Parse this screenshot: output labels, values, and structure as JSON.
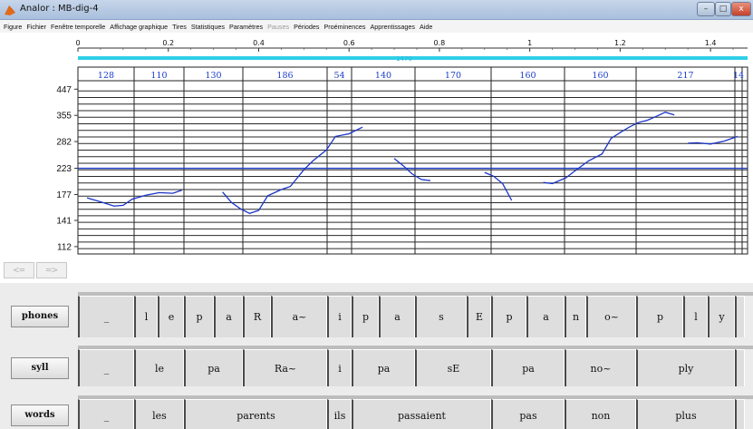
{
  "window": {
    "title": "Analor : MB-dig-4",
    "icon": "matlab-icon",
    "controls": {
      "minimize": "–",
      "maximize": "□",
      "close": "x"
    }
  },
  "menu": {
    "items": [
      {
        "label": "Figure",
        "enabled": true
      },
      {
        "label": "Fichier",
        "enabled": true
      },
      {
        "label": "Fenêtre temporelle",
        "enabled": true
      },
      {
        "label": "Affichage graphique",
        "enabled": true
      },
      {
        "label": "Tires",
        "enabled": true
      },
      {
        "label": "Statistiques",
        "enabled": true
      },
      {
        "label": "Paramètres",
        "enabled": true
      },
      {
        "label": "Pauses",
        "enabled": false
      },
      {
        "label": "Périodes",
        "enabled": true
      },
      {
        "label": "Proéminences",
        "enabled": true
      },
      {
        "label": "Apprentissages",
        "enabled": true
      },
      {
        "label": "Aide",
        "enabled": true
      }
    ]
  },
  "time_axis": {
    "range": [
      0,
      1.47
    ],
    "ticks": [
      "0",
      "0.2",
      "0.4",
      "0.6",
      "0.8",
      "1",
      "1.2",
      "1.4"
    ],
    "duration_label": "1470",
    "bar_color": "#2fd0e8"
  },
  "segment_durations": [
    "128",
    "110",
    "130",
    "186",
    "54",
    "140",
    "170",
    "160",
    "160",
    "217",
    "14"
  ],
  "chart_data": {
    "type": "line",
    "title": "",
    "xlabel": "",
    "ylabel": "",
    "y_ticks": [
      "447",
      "355",
      "282",
      "223",
      "177",
      "141",
      "112"
    ],
    "y_tick_values": [
      447,
      355,
      282,
      223,
      177,
      141,
      112
    ],
    "ylim": [
      105,
      470
    ],
    "y_scale": "log",
    "reference_line": 223,
    "reference_color": "#2040c8",
    "line_color": "#1a33c8",
    "series": [
      {
        "x": [
          0.02,
          0.05,
          0.08,
          0.1,
          0.12,
          0.15,
          0.18,
          0.21,
          0.23
        ],
        "y": [
          172,
          166,
          160,
          161,
          170,
          176,
          180,
          179,
          184
        ]
      },
      {
        "x": [
          0.32,
          0.34,
          0.36,
          0.38,
          0.4,
          0.42,
          0.45,
          0.47,
          0.5,
          0.52,
          0.55,
          0.57,
          0.6,
          0.63
        ],
        "y": [
          181,
          165,
          156,
          150,
          154,
          175,
          185,
          190,
          220,
          238,
          262,
          295,
          302,
          320
        ]
      },
      {
        "x": [
          0.7,
          0.72,
          0.74,
          0.76,
          0.78
        ],
        "y": [
          243,
          228,
          212,
          202,
          200
        ]
      },
      {
        "x": [
          0.9,
          0.92,
          0.94,
          0.96
        ],
        "y": [
          215,
          208,
          195,
          168
        ]
      },
      {
        "x": [
          1.03,
          1.05,
          1.08,
          1.1,
          1.13,
          1.16,
          1.18,
          1.2,
          1.22,
          1.24,
          1.26,
          1.28,
          1.3,
          1.32
        ],
        "y": [
          197,
          195,
          205,
          218,
          238,
          253,
          290,
          305,
          320,
          333,
          340,
          352,
          365,
          356
        ]
      },
      {
        "x": [
          1.35,
          1.37,
          1.4,
          1.43,
          1.46
        ],
        "y": [
          278,
          279,
          276,
          283,
          295
        ]
      }
    ]
  },
  "nav": {
    "prev": "<=",
    "next": "=>"
  },
  "tiers": [
    {
      "name": "phones",
      "cells": [
        "_",
        "l",
        "e",
        "p",
        "a",
        "R",
        "a~",
        "i",
        "p",
        "a",
        "s",
        "E",
        "p",
        "a",
        "n",
        "o~",
        "p",
        "l",
        "y",
        ""
      ]
    },
    {
      "name": "syll",
      "cells": [
        "_",
        "le",
        "pa",
        "Ra~",
        "i",
        "pa",
        "sE",
        "pa",
        "no~",
        "ply",
        ""
      ]
    },
    {
      "name": "words",
      "cells": [
        "_",
        "les",
        "parents",
        "ils",
        "passaient",
        "pas",
        "non",
        "plus",
        ""
      ]
    }
  ]
}
